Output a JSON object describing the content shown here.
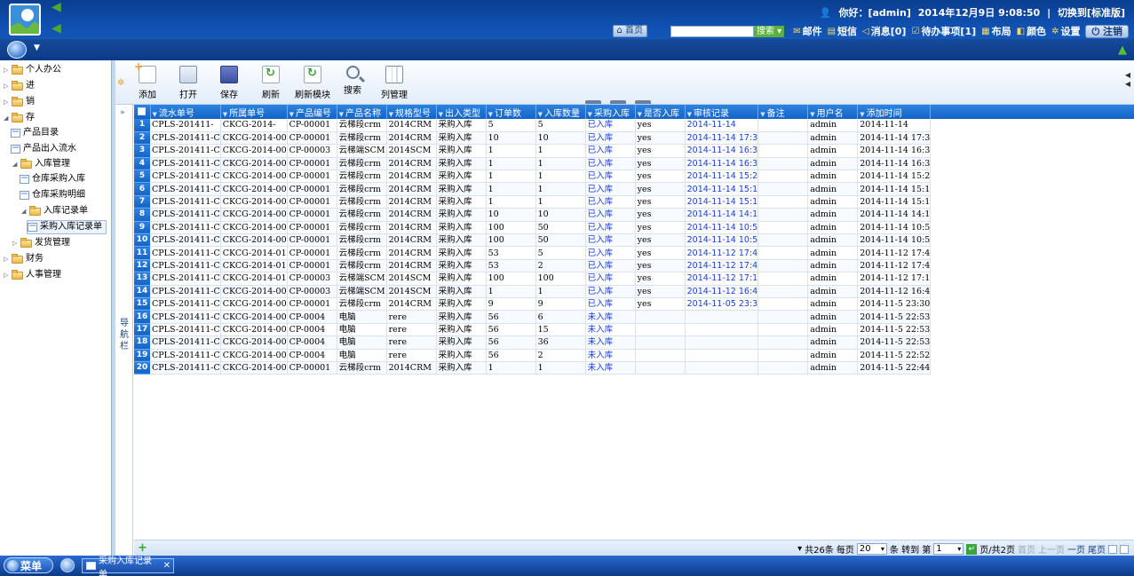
{
  "header": {
    "greeting": "你好：[admin]",
    "datetime": "2014年12月9日 9:08:50",
    "switch_label": "切换到[标准版]",
    "home_label": "首页",
    "search_label": "搜索",
    "items": [
      {
        "label": "邮件"
      },
      {
        "label": "短信"
      },
      {
        "label": "消息[0]"
      },
      {
        "label": "待办事项[1]"
      },
      {
        "label": "布局"
      },
      {
        "label": "颜色"
      },
      {
        "label": "设置"
      }
    ],
    "logout_label": "注销"
  },
  "sidebar": {
    "nodes": [
      {
        "label": "个人办公"
      },
      {
        "label": "进"
      },
      {
        "label": "销"
      },
      {
        "label": "存"
      },
      {
        "label": "产品目录"
      },
      {
        "label": "产品出入流水"
      },
      {
        "label": "入库管理"
      },
      {
        "label": "仓库采购入库"
      },
      {
        "label": "仓库采购明细"
      },
      {
        "label": "入库记录单"
      },
      {
        "label": "采购入库记录单"
      },
      {
        "label": "发货管理"
      },
      {
        "label": "财务"
      },
      {
        "label": "人事管理"
      }
    ],
    "collapse_label": "导航栏"
  },
  "toolbar": {
    "add": "添加",
    "open": "打开",
    "save": "保存",
    "refresh": "刷新",
    "refresh_module": "刷新模块",
    "search": "搜索",
    "columns": "列管理"
  },
  "grid": {
    "columns": [
      "流水单号",
      "所属单号",
      "产品编号",
      "产品名称",
      "规格型号",
      "出入类型",
      "订单数",
      "入库数量",
      "采购入库",
      "是否入库",
      "审核记录",
      "备注",
      "用户名",
      "添加时间"
    ],
    "rows": [
      [
        "1",
        "CPLS-201411-",
        "CKCG-2014-",
        "CP-00001",
        "云梯段crm",
        "2014CRM",
        "采购入库",
        "5",
        "5",
        "已入库",
        "yes",
        "2014-11-14",
        "",
        "admin",
        "2014-11-14"
      ],
      [
        "2",
        "CPLS-201411-C",
        "CKCG-2014-00",
        "CP-00001",
        "云梯段crm",
        "2014CRM",
        "采购入库",
        "10",
        "10",
        "已入库",
        "yes",
        "2014-11-14 17:3",
        "",
        "admin",
        "2014-11-14 17:3"
      ],
      [
        "3",
        "CPLS-201411-C",
        "CKCG-2014-00",
        "CP-00003",
        "云梯端SCM",
        "2014SCM",
        "采购入库",
        "1",
        "1",
        "已入库",
        "yes",
        "2014-11-14 16:3",
        "",
        "admin",
        "2014-11-14 16:3"
      ],
      [
        "4",
        "CPLS-201411-C",
        "CKCG-2014-00",
        "CP-00001",
        "云梯段crm",
        "2014CRM",
        "采购入库",
        "1",
        "1",
        "已入库",
        "yes",
        "2014-11-14 16:3",
        "",
        "admin",
        "2014-11-14 16:3"
      ],
      [
        "5",
        "CPLS-201411-C",
        "CKCG-2014-00",
        "CP-00001",
        "云梯段crm",
        "2014CRM",
        "采购入库",
        "1",
        "1",
        "已入库",
        "yes",
        "2014-11-14 15:2",
        "",
        "admin",
        "2014-11-14 15:2"
      ],
      [
        "6",
        "CPLS-201411-C",
        "CKCG-2014-00",
        "CP-00001",
        "云梯段crm",
        "2014CRM",
        "采购入库",
        "1",
        "1",
        "已入库",
        "yes",
        "2014-11-14 15:1",
        "",
        "admin",
        "2014-11-14 15:1"
      ],
      [
        "7",
        "CPLS-201411-C",
        "CKCG-2014-00",
        "CP-00001",
        "云梯段crm",
        "2014CRM",
        "采购入库",
        "1",
        "1",
        "已入库",
        "yes",
        "2014-11-14 15:1",
        "",
        "admin",
        "2014-11-14 15:1"
      ],
      [
        "8",
        "CPLS-201411-C",
        "CKCG-2014-00",
        "CP-00001",
        "云梯段crm",
        "2014CRM",
        "采购入库",
        "10",
        "10",
        "已入库",
        "yes",
        "2014-11-14 14:1",
        "",
        "admin",
        "2014-11-14 14:1"
      ],
      [
        "9",
        "CPLS-201411-C",
        "CKCG-2014-00",
        "CP-00001",
        "云梯段crm",
        "2014CRM",
        "采购入库",
        "100",
        "50",
        "已入库",
        "yes",
        "2014-11-14 10:5",
        "",
        "admin",
        "2014-11-14 10:5"
      ],
      [
        "10",
        "CPLS-201411-C",
        "CKCG-2014-00",
        "CP-00001",
        "云梯段crm",
        "2014CRM",
        "采购入库",
        "100",
        "50",
        "已入库",
        "yes",
        "2014-11-14 10:5",
        "",
        "admin",
        "2014-11-14 10:5"
      ],
      [
        "11",
        "CPLS-201411-C",
        "CKCG-2014-01",
        "CP-00001",
        "云梯段crm",
        "2014CRM",
        "采购入库",
        "53",
        "5",
        "已入库",
        "yes",
        "2014-11-12 17:4",
        "",
        "admin",
        "2014-11-12 17:4"
      ],
      [
        "12",
        "CPLS-201411-C",
        "CKCG-2014-01",
        "CP-00001",
        "云梯段crm",
        "2014CRM",
        "采购入库",
        "53",
        "2",
        "已入库",
        "yes",
        "2014-11-12 17:4",
        "",
        "admin",
        "2014-11-12 17:4"
      ],
      [
        "13",
        "CPLS-201411-C",
        "CKCG-2014-01",
        "CP-00003",
        "云梯端SCM",
        "2014SCM",
        "采购入库",
        "100",
        "100",
        "已入库",
        "yes",
        "2014-11-12 17:1",
        "",
        "admin",
        "2014-11-12 17:1"
      ],
      [
        "14",
        "CPLS-201411-C",
        "CKCG-2014-00",
        "CP-00003",
        "云梯端SCM",
        "2014SCM",
        "采购入库",
        "1",
        "1",
        "已入库",
        "yes",
        "2014-11-12 16:4",
        "",
        "admin",
        "2014-11-12 16:4"
      ],
      [
        "15",
        "CPLS-201411-C",
        "CKCG-2014-00",
        "CP-00001",
        "云梯段crm",
        "2014CRM",
        "采购入库",
        "9",
        "9",
        "已入库",
        "yes",
        "2014-11-05 23:3",
        "",
        "admin",
        "2014-11-5 23:30"
      ],
      [
        "16",
        "CPLS-201411-C",
        "CKCG-2014-00",
        "CP-0004",
        "电脑",
        "rere",
        "采购入库",
        "56",
        "6",
        "未入库",
        "",
        "",
        "",
        "admin",
        "2014-11-5 22:53"
      ],
      [
        "17",
        "CPLS-201411-C",
        "CKCG-2014-00",
        "CP-0004",
        "电脑",
        "rere",
        "采购入库",
        "56",
        "15",
        "未入库",
        "",
        "",
        "",
        "admin",
        "2014-11-5 22:53"
      ],
      [
        "18",
        "CPLS-201411-C",
        "CKCG-2014-00",
        "CP-0004",
        "电脑",
        "rere",
        "采购入库",
        "56",
        "36",
        "未入库",
        "",
        "",
        "",
        "admin",
        "2014-11-5 22:53"
      ],
      [
        "19",
        "CPLS-201411-C",
        "CKCG-2014-00",
        "CP-0004",
        "电脑",
        "rere",
        "采购入库",
        "56",
        "2",
        "未入库",
        "",
        "",
        "",
        "admin",
        "2014-11-5 22:52"
      ],
      [
        "20",
        "CPLS-201411-C",
        "CKCG-2014-00",
        "CP-00001",
        "云梯段crm",
        "2014CRM",
        "采购入库",
        "1",
        "1",
        "未入库",
        "",
        "",
        "",
        "admin",
        "2014-11-5 22:44"
      ]
    ]
  },
  "pager": {
    "total": "共26条",
    "per_page_label": "每页",
    "per_page_value": "20",
    "goto_label": "条 转到 第",
    "page_value": "1",
    "page_of": "页/共2页",
    "first": "首页",
    "prev": "上一页",
    "next": "一页",
    "last": "尾页"
  },
  "taskbar": {
    "menu_label": "菜单",
    "tab_label": "采购入库记录单"
  },
  "colors": {
    "header_blue": "#0f4fae",
    "grid_header": "#1f74d8",
    "link_blue": "#1a3fd4",
    "accent_green": "#3aa53a"
  }
}
